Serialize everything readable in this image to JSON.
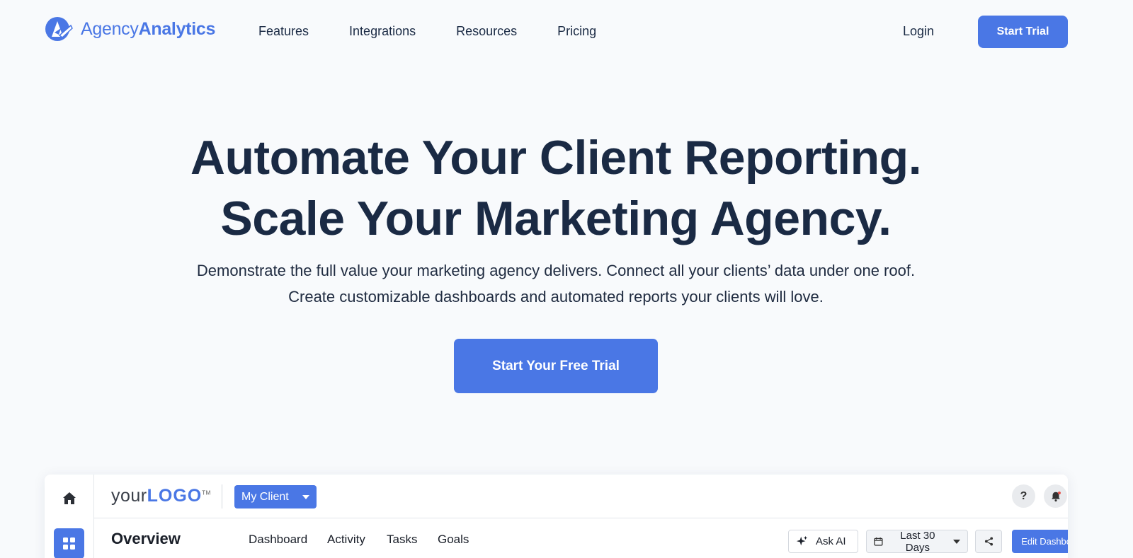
{
  "brand": {
    "name_light": "Agency",
    "name_bold": "Analytics",
    "accent": "#4a77e5",
    "text": "#1a2a44"
  },
  "nav": {
    "links": [
      "Features",
      "Integrations",
      "Resources",
      "Pricing"
    ],
    "login": "Login",
    "cta": "Start Trial"
  },
  "hero": {
    "title_line1": "Automate Your Client Reporting.",
    "title_line2": "Scale Your Marketing Agency.",
    "subtitle": "Demonstrate the full value your marketing agency delivers. Connect all your clients’ data under one roof. Create customizable dashboards and automated reports your clients will love.",
    "cta": "Start Your Free Trial"
  },
  "app": {
    "logo_light": "your",
    "logo_bold": "LOGO",
    "logo_tm": "TM",
    "client_selector": "My Client",
    "help_label": "?",
    "page_title": "Overview",
    "tabs": [
      "Dashboard",
      "Activity",
      "Tasks",
      "Goals"
    ],
    "ask_ai": "Ask AI",
    "date_range": "Last 30 Days",
    "edit_dashboard": "Edit Dashboard",
    "icons": [
      "home-icon",
      "grid-icon",
      "help-icon",
      "bell-icon",
      "sparkle-icon",
      "calendar-icon",
      "share-icon"
    ]
  }
}
